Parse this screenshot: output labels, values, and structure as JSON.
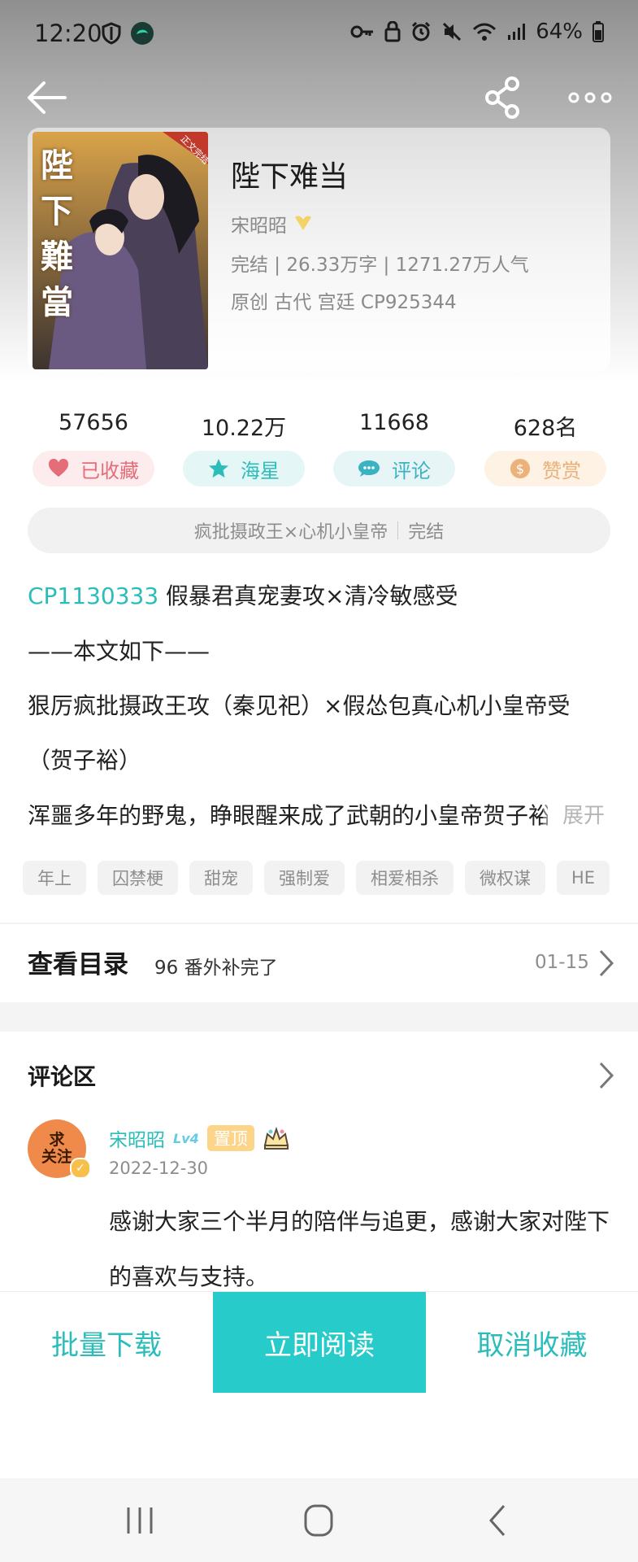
{
  "status_bar": {
    "time": "12:20",
    "battery": "64%",
    "left_icons": [
      "shield-icon",
      "app-status-icon"
    ],
    "right_icons": [
      "key-icon",
      "lock-icon",
      "alarm-icon",
      "mute-icon",
      "wifi-icon",
      "signal-icon",
      "battery-icon"
    ]
  },
  "nav": {
    "back_icon": "arrow-left-icon",
    "share_icon": "share-icon",
    "more_icon": "more-icon"
  },
  "book": {
    "title": "陛下难当",
    "author": "宋昭昭",
    "stats": "完结 | 26.33万字 | 1271.27万人气",
    "tags_line": "原创  古代  宫廷  CP925344",
    "cover_title": "陛下難當",
    "cover_ribbon": "正文完结"
  },
  "metrics": [
    {
      "value": "57656",
      "label": "已收藏",
      "icon": "heart-icon",
      "color": "#e46d78"
    },
    {
      "value": "10.22万",
      "label": "海星",
      "icon": "star-icon",
      "color": "#2cbdbb"
    },
    {
      "value": "11668",
      "label": "评论",
      "icon": "chat-icon",
      "color": "#3bb2c2"
    },
    {
      "value": "628名",
      "label": "赞赏",
      "icon": "coin-icon",
      "color": "#e9b17a"
    }
  ],
  "banner": {
    "text": "疯批摄政王×心机小皇帝",
    "status": "完结"
  },
  "description": {
    "cp_link": "CP1130333",
    "line1_rest": " 假暴君真宠妻攻×清冷敏感受",
    "line2": "——本文如下——",
    "line3": "狠厉疯批摄政王攻（秦见祀）×假怂包真心机小皇帝受",
    "line4": "（贺子裕）",
    "line5": "浑噩多年的野鬼，睁眼醒来成了武朝的小皇帝贺子裕",
    "expand": "展开"
  },
  "chips": [
    "年上",
    "囚禁梗",
    "甜宠",
    "强制爱",
    "相爱相杀",
    "微权谋",
    "HE"
  ],
  "catalog": {
    "title": "查看目录",
    "latest": "96 番外补完了",
    "date": "01-15"
  },
  "comments": {
    "title": "评论区",
    "items": [
      {
        "avatar_line1": "求",
        "avatar_line2": "关注",
        "user": "宋昭昭",
        "level": "Lv4",
        "pin": "置顶",
        "date": "2022-12-30",
        "text": "感谢大家三个半月的陪伴与追更，感谢大家对陛下的喜欢与支持。"
      }
    ]
  },
  "actions": {
    "download": "批量下载",
    "read": "立即阅读",
    "unfavorite": "取消收藏"
  },
  "colors": {
    "accent": "#2cbdbb",
    "read_button": "#27cbc9"
  }
}
